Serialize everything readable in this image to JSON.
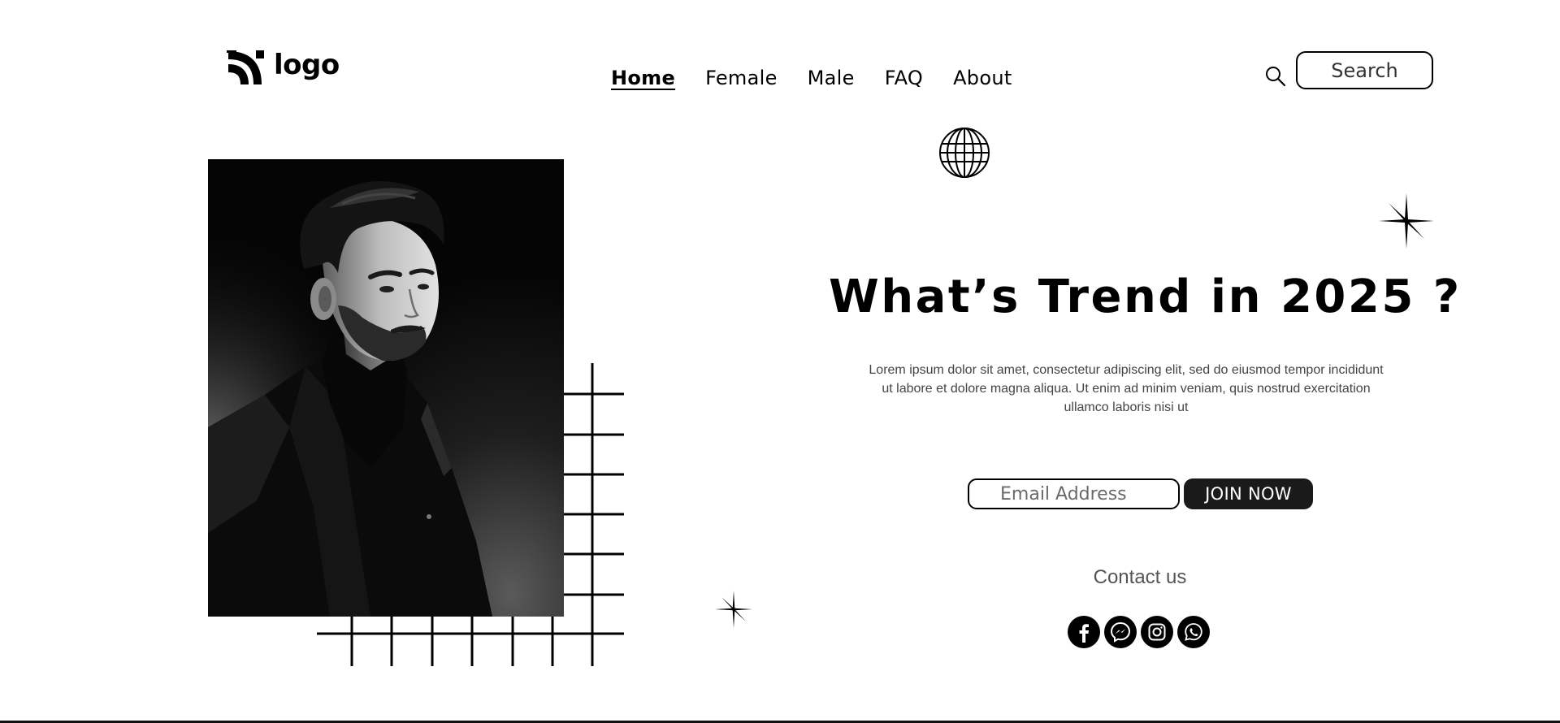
{
  "header": {
    "logo_text": "logo",
    "nav": [
      {
        "label": "Home",
        "active": true
      },
      {
        "label": "Female",
        "active": false
      },
      {
        "label": "Male",
        "active": false
      },
      {
        "label": "FAQ",
        "active": false
      },
      {
        "label": "About",
        "active": false
      }
    ],
    "search_label": "Search",
    "search_icon": "search-icon"
  },
  "hero": {
    "title": "What’s Trend in 2025 ?",
    "description": "Lorem ipsum dolor sit amet, consectetur adipiscing elit, sed do eiusmod tempor incididunt ut labore et dolore magna aliqua. Ut enim ad minim veniam, quis nostrud exercitation ullamco laboris nisi ut",
    "email_placeholder": "Email Address",
    "join_label": "JOIN NOW"
  },
  "contact": {
    "label": "Contact us",
    "socials": [
      "facebook-icon",
      "messenger-icon",
      "instagram-icon",
      "whatsapp-icon"
    ]
  },
  "colors": {
    "primary": "#000000",
    "button_bg": "#1a1a1a",
    "background": "#ffffff"
  }
}
